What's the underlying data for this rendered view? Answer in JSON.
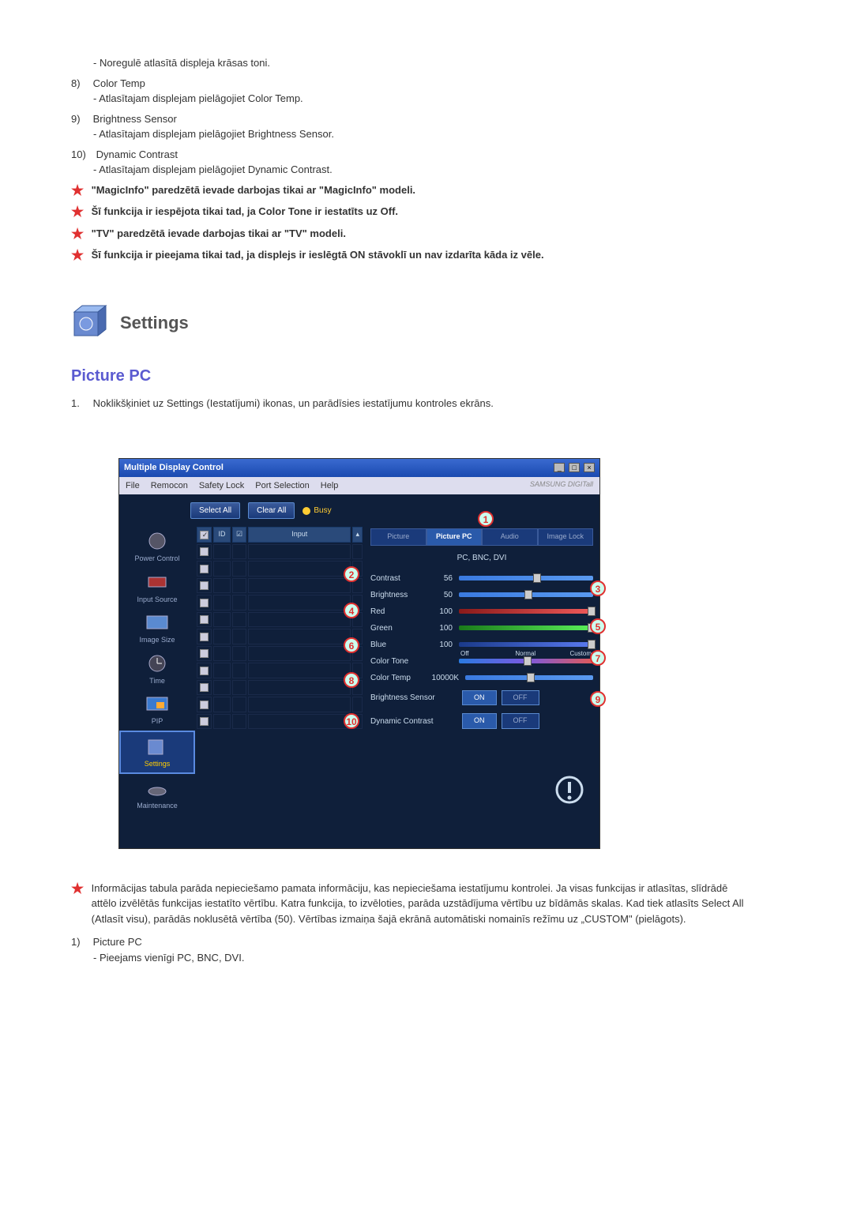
{
  "top_list": [
    {
      "sub": "- Noregulē atlasītā displeja krāsas toni."
    },
    {
      "num": "8)",
      "title": "Color Temp",
      "sub": "- Atlasītajam displejam pielāgojiet Color Temp."
    },
    {
      "num": "9)",
      "title": "Brightness Sensor",
      "sub": "- Atlasītajam displejam pielāgojiet Brightness Sensor."
    },
    {
      "num": "10)",
      "title": "Dynamic Contrast",
      "sub": "- Atlasītajam displejam pielāgojiet Dynamic Contrast."
    }
  ],
  "stars": [
    "\"MagicInfo\" paredzētā ievade darbojas tikai ar \"MagicInfo\" modeli.",
    "Šī funkcija ir iespējota tikai tad, ja Color Tone ir iestatīts uz Off.",
    "\"TV\" paredzētā ievade darbojas tikai ar \"TV\" modeli.",
    "Šī funkcija ir pieejama tikai tad, ja displejs ir ieslēgtā ON stāvoklī un nav izdarīta kāda iz vēle."
  ],
  "section": {
    "title": "Settings",
    "sub_title": "Picture PC",
    "step1_num": "1.",
    "step1": "Noklikšķiniet uz Settings (Iestatījumi) ikonas, un parādīsies iestatījumu kontroles ekrāns."
  },
  "app": {
    "title": "Multiple Display Control",
    "brand": "SAMSUNG DIGITall",
    "menus": [
      "File",
      "Remocon",
      "Safety Lock",
      "Port Selection",
      "Help"
    ],
    "select_all": "Select All",
    "clear_all": "Clear All",
    "busy": "Busy",
    "cols": {
      "id": "ID",
      "input": "Input"
    },
    "sidebar": [
      "Power Control",
      "Input Source",
      "Image Size",
      "Time",
      "PIP",
      "Settings",
      "Maintenance"
    ],
    "tabs": [
      "Picture",
      "Picture PC",
      "Audio",
      "Image Lock"
    ],
    "source_label": "PC, BNC, DVI",
    "rows": {
      "contrast": {
        "label": "Contrast",
        "value": "56"
      },
      "brightness": {
        "label": "Brightness",
        "value": "50"
      },
      "red": {
        "label": "Red",
        "value": "100"
      },
      "green": {
        "label": "Green",
        "value": "100"
      },
      "blue": {
        "label": "Blue",
        "value": "100"
      },
      "color_tone": {
        "label": "Color Tone",
        "off": "Off",
        "normal": "Normal",
        "custom": "Custom"
      },
      "color_temp": {
        "label": "Color Temp",
        "value": "10000K"
      },
      "brightness_sensor": {
        "label": "Brightness Sensor",
        "on": "ON",
        "off": "OFF"
      },
      "dynamic_contrast": {
        "label": "Dynamic Contrast",
        "on": "ON",
        "off": "OFF"
      }
    },
    "callouts": [
      "1",
      "2",
      "3",
      "4",
      "5",
      "6",
      "7",
      "8",
      "9",
      "10"
    ]
  },
  "bottom": {
    "star_note": "Informācijas tabula parāda nepieciešamo pamata informāciju, kas nepieciešama iestatījumu kontrolei. Ja visas funkcijas ir atlasītas, slīdrādē attēlo izvēlētās funkcijas iestatīto vērtību. Katra funkcija, to izvēloties, parāda uzstādījuma vērtību uz bīdāmās skalas. Kad tiek atlasīts Select All (Atlasīt visu), parādās noklusētā vērtība (50). Vērtības izmaiņa šajā ekrānā automātiski nomainīs režīmu uz „CUSTOM\" (pielāgots).",
    "item1_num": "1)",
    "item1_title": "Picture PC",
    "item1_sub": "- Pieejams vienīgi PC, BNC, DVI."
  }
}
